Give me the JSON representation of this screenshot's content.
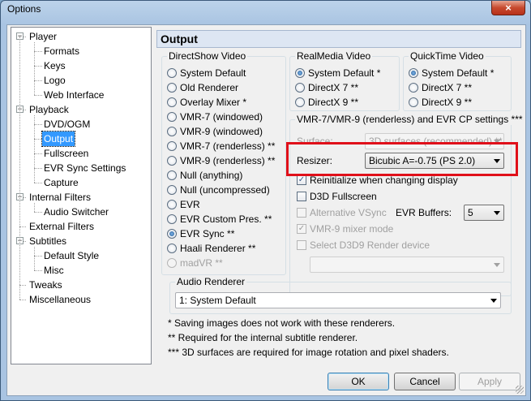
{
  "window": {
    "title": "Options",
    "close_glyph": "×"
  },
  "tree": [
    {
      "label": "Player",
      "level": 0,
      "expander": "−"
    },
    {
      "label": "Formats",
      "level": 1
    },
    {
      "label": "Keys",
      "level": 1
    },
    {
      "label": "Logo",
      "level": 1
    },
    {
      "label": "Web Interface",
      "level": 1
    },
    {
      "label": "Playback",
      "level": 0,
      "expander": "−"
    },
    {
      "label": "DVD/OGM",
      "level": 1
    },
    {
      "label": "Output",
      "level": 1,
      "selected": true
    },
    {
      "label": "Fullscreen",
      "level": 1
    },
    {
      "label": "EVR Sync Settings",
      "level": 1
    },
    {
      "label": "Capture",
      "level": 1
    },
    {
      "label": "Internal Filters",
      "level": 0,
      "expander": "−"
    },
    {
      "label": "Audio Switcher",
      "level": 1
    },
    {
      "label": "External Filters",
      "level": 0
    },
    {
      "label": "Subtitles",
      "level": 0,
      "expander": "−"
    },
    {
      "label": "Default Style",
      "level": 1
    },
    {
      "label": "Misc",
      "level": 1
    },
    {
      "label": "Tweaks",
      "level": 0
    },
    {
      "label": "Miscellaneous",
      "level": 0
    }
  ],
  "page_title": "Output",
  "directshow": {
    "title": "DirectShow Video",
    "options": [
      {
        "label": "System Default",
        "checked": false,
        "disabled": false
      },
      {
        "label": "Old Renderer",
        "checked": false,
        "disabled": false
      },
      {
        "label": "Overlay Mixer *",
        "checked": false,
        "disabled": false
      },
      {
        "label": "VMR-7 (windowed)",
        "checked": false,
        "disabled": false
      },
      {
        "label": "VMR-9 (windowed)",
        "checked": false,
        "disabled": false
      },
      {
        "label": "VMR-7 (renderless) **",
        "checked": false,
        "disabled": false
      },
      {
        "label": "VMR-9 (renderless) **",
        "checked": false,
        "disabled": false
      },
      {
        "label": "Null (anything)",
        "checked": false,
        "disabled": false
      },
      {
        "label": "Null (uncompressed)",
        "checked": false,
        "disabled": false
      },
      {
        "label": "EVR",
        "checked": false,
        "disabled": false
      },
      {
        "label": "EVR Custom Pres. **",
        "checked": false,
        "disabled": false
      },
      {
        "label": "EVR Sync **",
        "checked": true,
        "disabled": false
      },
      {
        "label": "Haali Renderer **",
        "checked": false,
        "disabled": false
      },
      {
        "label": "madVR **",
        "checked": false,
        "disabled": true
      }
    ]
  },
  "realmedia": {
    "title": "RealMedia Video",
    "options": [
      {
        "label": "System Default *",
        "checked": true
      },
      {
        "label": "DirectX 7 **",
        "checked": false
      },
      {
        "label": "DirectX 9 **",
        "checked": false
      }
    ]
  },
  "quicktime": {
    "title": "QuickTime Video",
    "options": [
      {
        "label": "System Default *",
        "checked": true
      },
      {
        "label": "DirectX 7 **",
        "checked": false
      },
      {
        "label": "DirectX 9 **",
        "checked": false
      }
    ]
  },
  "vmr": {
    "title": "VMR-7/VMR-9 (renderless) and EVR CP settings ***",
    "surface_label": "Surface:",
    "surface_value": "3D surfaces (recommended) **",
    "resizer_label": "Resizer:",
    "resizer_value": "Bicubic A=-0.75 (PS 2.0)",
    "reinit_label": "Reinitialize when changing display",
    "d3d_fullscreen_label": "D3D Fullscreen",
    "alt_vsync_label": "Alternative VSync",
    "evr_buffers_label": "EVR Buffers:",
    "evr_buffers_value": "5",
    "vmr9_mixer_label": "VMR-9 mixer mode",
    "select_d3d9_label": "Select D3D9 Render device",
    "d3d9_device_value": ""
  },
  "audio": {
    "title": "Audio Renderer",
    "value": "1: System Default"
  },
  "notes": [
    "* Saving images does not work with these renderers.",
    "** Required for the internal subtitle renderer.",
    "*** 3D surfaces are required for image rotation and pixel shaders."
  ],
  "buttons": {
    "ok": "OK",
    "cancel": "Cancel",
    "apply": "Apply"
  },
  "colors": {
    "highlight": "#e0101a",
    "selection": "#3399ff"
  }
}
